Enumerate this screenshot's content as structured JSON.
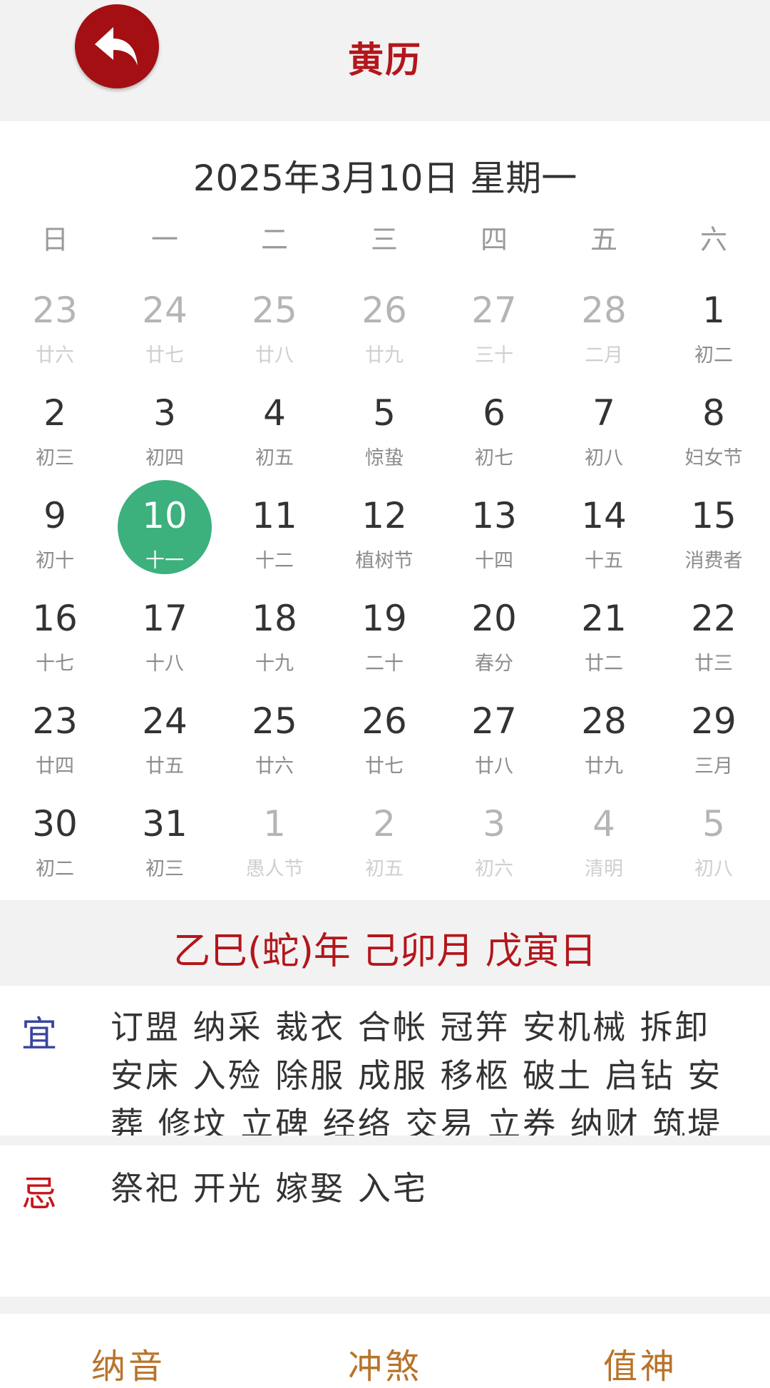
{
  "header": {
    "title": "黄历"
  },
  "date_line": "2025年3月10日 星期一",
  "weekdays": [
    "日",
    "一",
    "二",
    "三",
    "四",
    "五",
    "六"
  ],
  "calendar": {
    "rows": [
      [
        {
          "day": "23",
          "lunar": "廿六",
          "other": true
        },
        {
          "day": "24",
          "lunar": "廿七",
          "other": true
        },
        {
          "day": "25",
          "lunar": "廿八",
          "other": true
        },
        {
          "day": "26",
          "lunar": "廿九",
          "other": true
        },
        {
          "day": "27",
          "lunar": "三十",
          "other": true
        },
        {
          "day": "28",
          "lunar": "二月",
          "other": true
        },
        {
          "day": "1",
          "lunar": "初二",
          "other": false
        }
      ],
      [
        {
          "day": "2",
          "lunar": "初三"
        },
        {
          "day": "3",
          "lunar": "初四"
        },
        {
          "day": "4",
          "lunar": "初五"
        },
        {
          "day": "5",
          "lunar": "惊蛰"
        },
        {
          "day": "6",
          "lunar": "初七"
        },
        {
          "day": "7",
          "lunar": "初八"
        },
        {
          "day": "8",
          "lunar": "妇女节"
        }
      ],
      [
        {
          "day": "9",
          "lunar": "初十"
        },
        {
          "day": "10",
          "lunar": "十一",
          "today": true
        },
        {
          "day": "11",
          "lunar": "十二"
        },
        {
          "day": "12",
          "lunar": "植树节"
        },
        {
          "day": "13",
          "lunar": "十四"
        },
        {
          "day": "14",
          "lunar": "十五"
        },
        {
          "day": "15",
          "lunar": "消费者"
        }
      ],
      [
        {
          "day": "16",
          "lunar": "十七"
        },
        {
          "day": "17",
          "lunar": "十八"
        },
        {
          "day": "18",
          "lunar": "十九"
        },
        {
          "day": "19",
          "lunar": "二十"
        },
        {
          "day": "20",
          "lunar": "春分"
        },
        {
          "day": "21",
          "lunar": "廿二"
        },
        {
          "day": "22",
          "lunar": "廿三"
        }
      ],
      [
        {
          "day": "23",
          "lunar": "廿四"
        },
        {
          "day": "24",
          "lunar": "廿五"
        },
        {
          "day": "25",
          "lunar": "廿六"
        },
        {
          "day": "26",
          "lunar": "廿七"
        },
        {
          "day": "27",
          "lunar": "廿八"
        },
        {
          "day": "28",
          "lunar": "廿九"
        },
        {
          "day": "29",
          "lunar": "三月"
        }
      ],
      [
        {
          "day": "30",
          "lunar": "初二"
        },
        {
          "day": "31",
          "lunar": "初三"
        },
        {
          "day": "1",
          "lunar": "愚人节",
          "other": true
        },
        {
          "day": "2",
          "lunar": "初五",
          "other": true
        },
        {
          "day": "3",
          "lunar": "初六",
          "other": true
        },
        {
          "day": "4",
          "lunar": "清明",
          "other": true
        },
        {
          "day": "5",
          "lunar": "初八",
          "other": true
        }
      ]
    ]
  },
  "ganzhi": "乙巳(蛇)年 己卯月 戊寅日",
  "yi": {
    "label": "宜",
    "text": "订盟 纳采 裁衣 合帐 冠笄 安机械 拆卸 安床 入殓 除服 成服 移柩 破土 启钻 安葬 修坟 立碑 经络 交易 立券 纳财 筑堤"
  },
  "ji": {
    "label": "忌",
    "text": "祭祀 开光 嫁娶 入宅"
  },
  "bottom_tabs": [
    "纳音",
    "冲煞",
    "值神"
  ],
  "colors": {
    "accent_red": "#b3161b",
    "today_green": "#3cb07d",
    "yi_blue": "#3a44a0",
    "tab_gold": "#b8732a"
  },
  "icons": {
    "back": "back-arrow-icon"
  }
}
